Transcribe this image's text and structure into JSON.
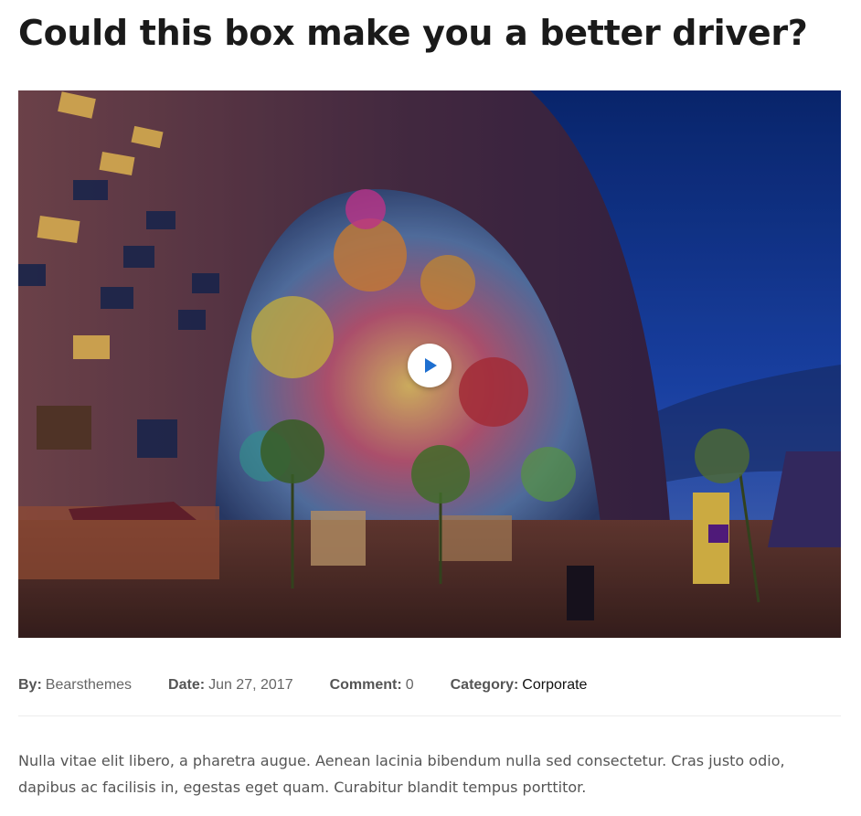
{
  "post": {
    "title": "Could this box make you a better driver?",
    "media": {
      "kind": "video",
      "play_icon": "play-icon"
    },
    "meta": {
      "by_label": "By:",
      "author": "Bearsthemes",
      "date_label": "Date:",
      "date": "Jun 27, 2017",
      "comment_label": "Comment:",
      "comment_count": "0",
      "category_label": "Category:",
      "category": "Corporate"
    },
    "excerpt": "Nulla vitae elit libero, a pharetra augue. Aenean lacinia bibendum nulla sed consectetur. Cras justo odio, dapibus ac facilisis in, egestas eget quam. Curabitur blandit tempus porttitor."
  },
  "colors": {
    "title": "#1a1a1a",
    "play_accent": "#1e6fd0",
    "link": "#111111",
    "meta_text": "#666666"
  }
}
